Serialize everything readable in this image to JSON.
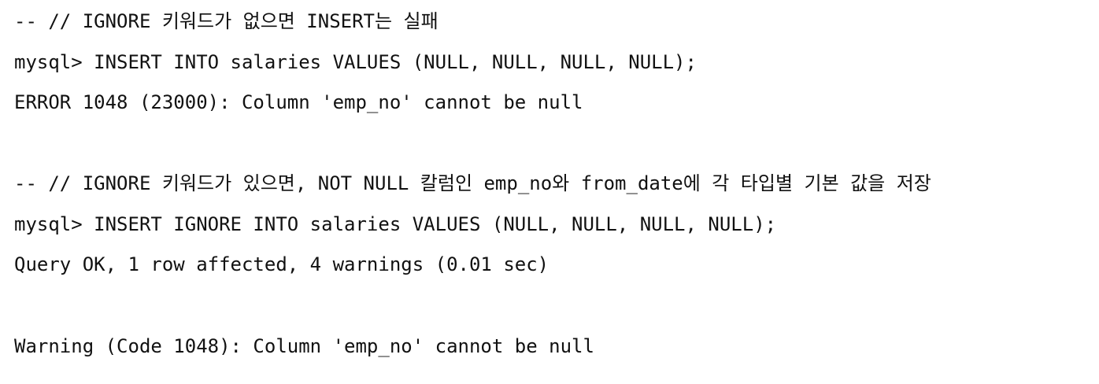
{
  "lines": [
    "-- // IGNORE 키워드가 없으면 INSERT는 실패",
    "mysql> INSERT INTO salaries VALUES (NULL, NULL, NULL, NULL);",
    "ERROR 1048 (23000): Column 'emp_no' cannot be null",
    "-- // IGNORE 키워드가 있으면, NOT NULL 칼럼인 emp_no와 from_date에 각 타입별 기본 값을 저장",
    "mysql> INSERT IGNORE INTO salaries VALUES (NULL, NULL, NULL, NULL);",
    "Query OK, 1 row affected, 4 warnings (0.01 sec)",
    "Warning (Code 1048): Column 'emp_no' cannot be null"
  ]
}
